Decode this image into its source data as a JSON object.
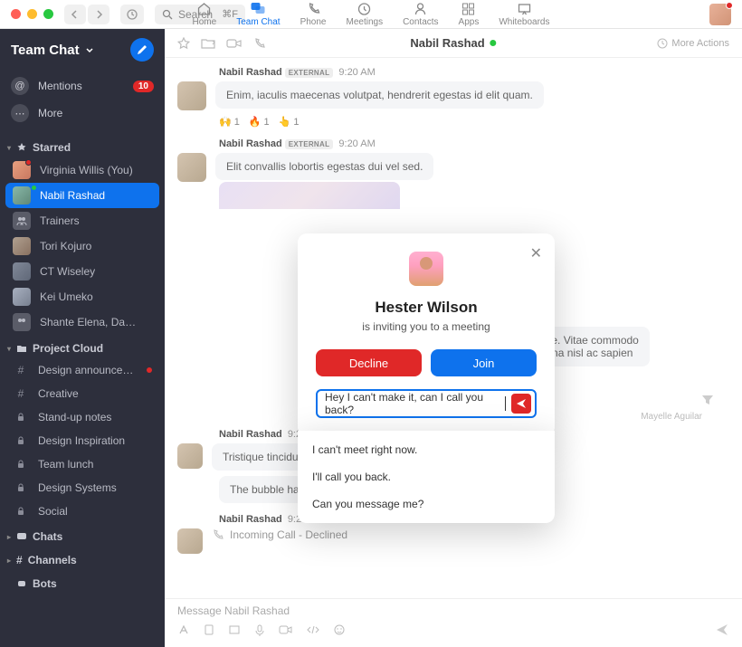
{
  "titlebar": {
    "search_placeholder": "Search",
    "search_shortcut": "⌘F",
    "tabs": [
      {
        "label": "Home"
      },
      {
        "label": "Team Chat"
      },
      {
        "label": "Phone"
      },
      {
        "label": "Meetings"
      },
      {
        "label": "Contacts"
      },
      {
        "label": "Apps"
      },
      {
        "label": "Whiteboards"
      }
    ]
  },
  "sidebar": {
    "title": "Team Chat",
    "mentions_label": "Mentions",
    "mentions_count": "10",
    "more_label": "More",
    "starred_label": "Starred",
    "starred": [
      {
        "label": "Virginia Willis (You)"
      },
      {
        "label": "Nabil Rashad"
      },
      {
        "label": "Trainers"
      },
      {
        "label": "Tori Kojuro"
      },
      {
        "label": "CT Wiseley"
      },
      {
        "label": "Kei Umeko"
      },
      {
        "label": "Shante Elena, Daniel Bow..."
      }
    ],
    "project_label": "Project Cloud",
    "project": [
      {
        "label": "Design announcements"
      },
      {
        "label": "Creative"
      },
      {
        "label": "Stand-up notes"
      },
      {
        "label": "Design Inspiration"
      },
      {
        "label": "Team lunch"
      },
      {
        "label": "Design Systems"
      },
      {
        "label": "Social"
      }
    ],
    "chats_label": "Chats",
    "channels_label": "Channels",
    "bots_label": "Bots"
  },
  "mainhead": {
    "title": "Nabil Rashad",
    "more": "More Actions"
  },
  "messages": {
    "m1": {
      "name": "Nabil Rashad",
      "ext": "EXTERNAL",
      "time": "9:20 AM",
      "text": "Enim, iaculis maecenas volutpat, hendrerit egestas id elit quam."
    },
    "react1": "1",
    "react2": "1",
    "react3": "1",
    "m2": {
      "name": "Nabil Rashad",
      "ext": "EXTERNAL",
      "time": "9:20 AM",
      "text": "Elit convallis lobortis egestas dui vel sed."
    },
    "m3a": "ris, vulputate. Vitae commodo",
    "m3b": "placerat. Urna nisl ac sapien",
    "sent": "Mayelle Aguilar",
    "m4": {
      "name": "Nabil Rashad",
      "time": "9:20 AM",
      "text": "Tristique tincidunt magna dolor ultrices."
    },
    "m5": {
      "text": "The bubble has auto layout"
    },
    "m6": {
      "name": "Nabil Rashad",
      "time": "9:20 AM",
      "text": "Incoming Call - Declined"
    }
  },
  "composer": {
    "placeholder": "Message Nabil Rashad"
  },
  "modal": {
    "name": "Hester Wilson",
    "sub": "is inviting you to a meeting",
    "decline": "Decline",
    "join": "Join",
    "input": "Hey I can't make it, can I call you back?",
    "suggestions": [
      "I can't meet right now.",
      "I'll call you back.",
      "Can you message me?"
    ]
  }
}
